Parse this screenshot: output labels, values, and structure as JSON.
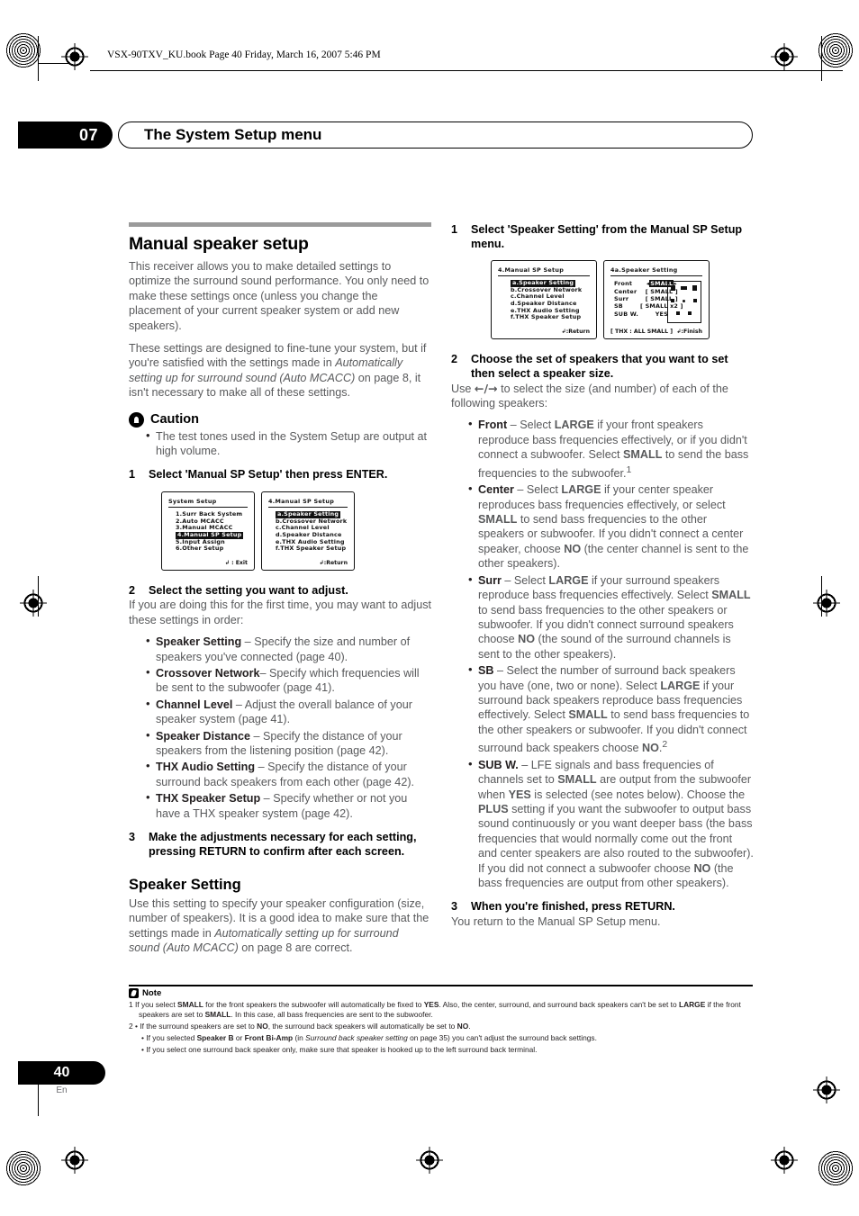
{
  "running_head": "VSX-90TXV_KU.book  Page 40  Friday, March 16, 2007  5:46 PM",
  "chapter": {
    "number": "07",
    "title": "The System Setup menu"
  },
  "footer": {
    "page": "40",
    "lang": "En"
  },
  "left_column": {
    "section_title": "Manual speaker setup",
    "intro_1": "This receiver allows you to make detailed settings to optimize the surround sound performance. You only need to make these settings once (unless you change the placement of your current speaker system or add new speakers).",
    "intro_2_a": "These settings are designed to fine-tune your system, but if you're satisfied with the settings made in ",
    "intro_2_i": "Automatically setting up for surround sound (Auto MCACC)",
    "intro_2_b": " on page 8, it isn't necessary to make all of these settings.",
    "caution_label": "Caution",
    "caution_bullet": "The test tones used in the System Setup are output at high volume.",
    "step1_num": "1",
    "step1_text": "Select 'Manual SP Setup' then press ENTER.",
    "step2_num": "2",
    "step2_text": "Select the setting you want to adjust.",
    "step2_body": "If you are doing this for the first time, you may want to adjust these settings in order:",
    "bullets": [
      {
        "term": "Speaker Setting",
        "desc": " – Specify the size and number of speakers you've connected (page 40)."
      },
      {
        "term": "Crossover Network",
        "desc": "– Specify which frequencies will be sent to the subwoofer (page 41)."
      },
      {
        "term": "Channel Level",
        "desc": " – Adjust the overall balance of your speaker system (page 41)."
      },
      {
        "term": "Speaker Distance",
        "desc": " – Specify the distance of your speakers from the listening position (page 42)."
      },
      {
        "term": "THX Audio Setting",
        "desc": " – Specify the distance of your surround back speakers from each other (page 42)."
      },
      {
        "term": "THX Speaker Setup",
        "desc": " – Specify whether or not you have a THX speaker system (page 42)."
      }
    ],
    "step3_num": "3",
    "step3_text": "Make the adjustments necessary for each setting, pressing RETURN to confirm after each screen.",
    "sub_title": "Speaker Setting",
    "sub_body_a": "Use this setting to specify your speaker configuration (size, number of speakers). It is a good idea to make sure that the settings made in ",
    "sub_body_i": "Automatically setting up for surround sound (Auto MCACC)",
    "sub_body_b": " on page 8 are correct."
  },
  "screens": {
    "system_setup": {
      "title": "System  Setup",
      "items": [
        "1.Surr  Back  System",
        "2.Auto  MCACC",
        "3.Manual  MCACC",
        "4.Manual  SP  Setup",
        "5.Input  Assign",
        "6.Other  Setup"
      ],
      "highlight_index": 3,
      "footer": "↲ : Exit"
    },
    "manual_sp_setup": {
      "title": "4.Manual  SP  Setup",
      "items": [
        "a.Speaker  Setting",
        "b.Crossover  Network",
        "c.Channel  Level",
        "d.Speaker  Distance",
        "e.THX  Audio  Setting",
        "f.THX  Speaker  Setup"
      ],
      "highlight_index": 0,
      "footer": "↲:Return"
    },
    "speaker_setting": {
      "title": "4a.Speaker  Setting",
      "rows": [
        {
          "label": "Front",
          "value": "SMALL",
          "selected": true
        },
        {
          "label": "Center",
          "value": "[ SMALL ]",
          "selected": false
        },
        {
          "label": "Surr",
          "value": "[ SMALL ]",
          "selected": false
        },
        {
          "label": "SB",
          "value": "[ SMALL x2 ]",
          "selected": false
        },
        {
          "label": "SUB W.",
          "value": "YES",
          "selected": false
        }
      ],
      "footer_left": "[ THX : ALL SMALL ]",
      "footer_right": "↲:Finish"
    }
  },
  "right_column": {
    "step1_num": "1",
    "step1_text": "Select 'Speaker Setting' from the Manual SP Setup menu.",
    "step2_num": "2",
    "step2_text": "Choose the set of speakers that you want to set then select a speaker size.",
    "step2_body_a": "Use ",
    "step2_body_arrows": "←/→",
    "step2_body_b": " to select the size (and number) of each of the following speakers:",
    "bullets": [
      {
        "term": "Front",
        "html": " – Select <b>LARGE</b> if your front speakers reproduce bass frequencies effectively, or if you didn't connect a subwoofer. Select <b>SMALL</b> to send the bass frequencies to the subwoofer.<sup>1</sup>"
      },
      {
        "term": "Center",
        "html": " – Select <b>LARGE</b> if your center speaker reproduces bass frequencies effectively, or select <b>SMALL</b> to send bass frequencies to the other speakers or subwoofer. If you didn't connect a center speaker, choose <b>NO</b> (the center channel is sent to the other speakers)."
      },
      {
        "term": "Surr",
        "html": " – Select <b>LARGE</b> if your surround speakers reproduce bass frequencies effectively. Select <b>SMALL</b> to send bass frequencies to the other speakers or subwoofer. If you didn't connect surround speakers choose <b>NO</b> (the sound of the surround channels is sent to the other speakers)."
      },
      {
        "term": "SB",
        "html": " – Select the number of surround back speakers you have (one, two or none). Select <b>LARGE</b> if your surround back speakers reproduce bass frequencies effectively. Select <b>SMALL</b> to send bass frequencies to the other speakers or subwoofer. If you didn't connect surround back speakers choose <b>NO</b>.<sup>2</sup>"
      },
      {
        "term": "SUB W.",
        "html": " – LFE signals and bass frequencies of channels set to <b>SMALL</b> are output from the subwoofer when <b>YES</b> is selected (see notes below). Choose the <b>PLUS</b> setting if you want the subwoofer to output bass sound continuously or you want deeper bass (the bass frequencies that would normally come out the front and center speakers are also routed to the subwoofer). If you did not connect a subwoofer choose <b>NO</b> (the bass frequencies are output from other speakers)."
      }
    ],
    "step3_num": "3",
    "step3_text": "When you're finished, press RETURN.",
    "step3_body": "You return to the Manual SP Setup menu."
  },
  "notes": {
    "label": "Note",
    "note1_html": "1 If you select <b>SMALL</b> for the front speakers the subwoofer will automatically be fixed to <b>YES</b>. Also, the center, surround, and surround back speakers can't be set to <b>LARGE</b> if the front speakers are set to <b>SMALL</b>. In this case, all bass frequencies are sent to the subwoofer.",
    "note2_html": "2 • If the surround speakers are set to <b>NO</b>, the surround back speakers will automatically be set to <b>NO</b>.",
    "note2b_html": "• If you selected <b>Speaker B</b> or <b>Front Bi-Amp</b> (in <i>Surround back speaker setting</i> on page 35) you can't adjust the surround back settings.",
    "note2c_html": "• If you select one surround back speaker only, make sure that speaker is hooked up to the left surround back terminal."
  }
}
